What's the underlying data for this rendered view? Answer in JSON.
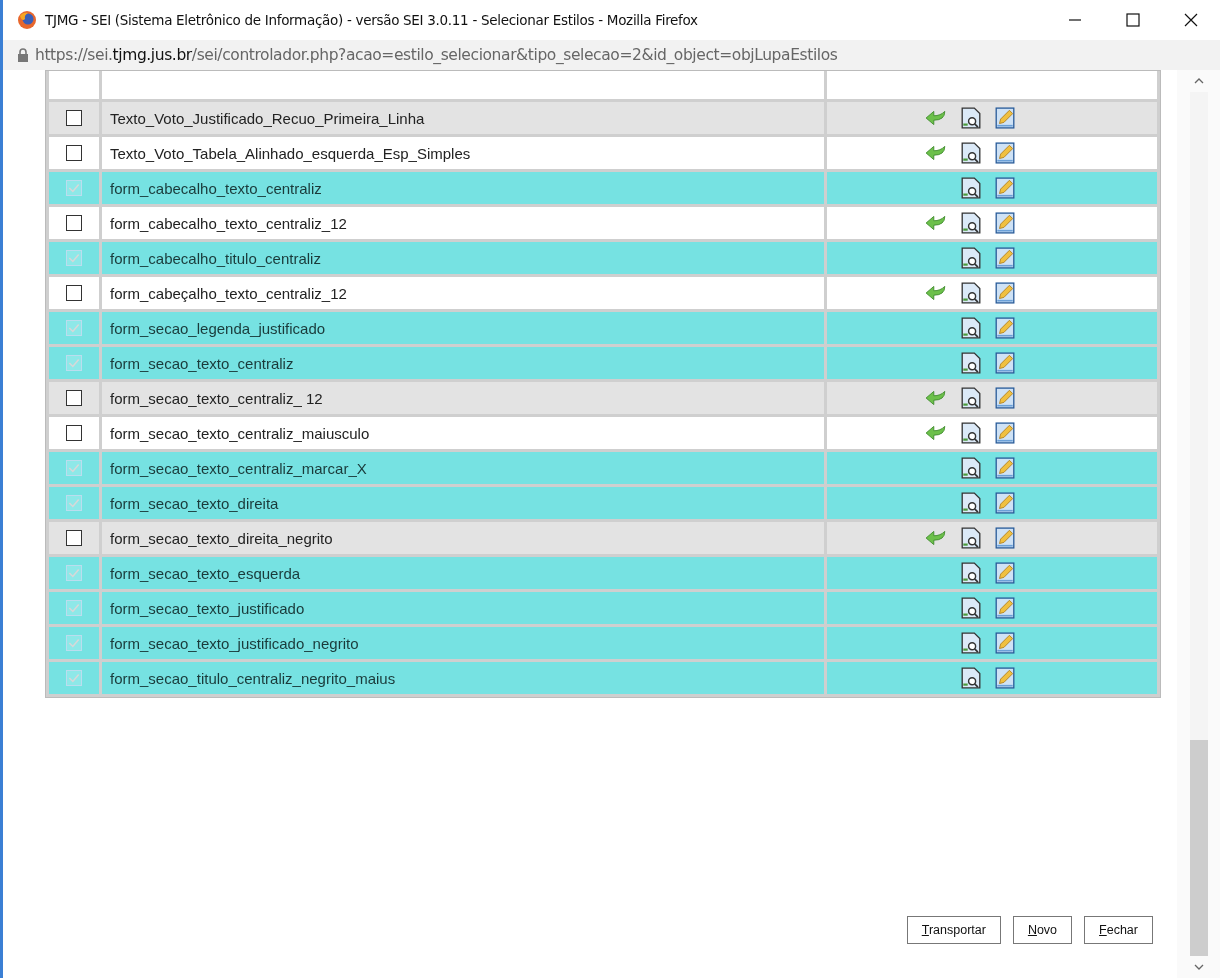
{
  "window": {
    "title": "TJMG - SEI (Sistema Eletrônico de Informação) - versão SEI 3.0.11 - Selecionar Estilos - Mozilla Firefox"
  },
  "address": {
    "prefix": "https://sei.",
    "domain": "tjmg.jus.br",
    "path": "/sei/controlador.php?acao=estilo_selecionar&tipo_selecao=2&id_object=objLupaEstilos"
  },
  "rows": [
    {
      "name": "Texto_Voto_Justificado_Recuo_Primeira_Linha",
      "selected": false,
      "shaded": true
    },
    {
      "name": "Texto_Voto_Tabela_Alinhado_esquerda_Esp_Simples",
      "selected": false,
      "shaded": false
    },
    {
      "name": "form_cabecalho_texto_centraliz",
      "selected": true
    },
    {
      "name": "form_cabecalho_texto_centraliz_12",
      "selected": false,
      "shaded": false
    },
    {
      "name": "form_cabecalho_titulo_centraliz",
      "selected": true
    },
    {
      "name": "form_cabeçalho_texto_centraliz_12",
      "selected": false,
      "shaded": false
    },
    {
      "name": "form_secao_legenda_justificado",
      "selected": true
    },
    {
      "name": "form_secao_texto_centraliz",
      "selected": true
    },
    {
      "name": "form_secao_texto_centraliz_ 12",
      "selected": false,
      "shaded": true
    },
    {
      "name": "form_secao_texto_centraliz_maiusculo",
      "selected": false,
      "shaded": false
    },
    {
      "name": "form_secao_texto_centraliz_marcar_X",
      "selected": true
    },
    {
      "name": "form_secao_texto_direita",
      "selected": true
    },
    {
      "name": "form_secao_texto_direita_negrito",
      "selected": false,
      "shaded": true
    },
    {
      "name": "form_secao_texto_esquerda",
      "selected": true
    },
    {
      "name": "form_secao_texto_justificado",
      "selected": true
    },
    {
      "name": "form_secao_texto_justificado_negrito",
      "selected": true
    },
    {
      "name": "form_secao_titulo_centraliz_negrito_maius",
      "selected": true
    }
  ],
  "buttons": [
    "Transportar",
    "Novo",
    "Fechar"
  ]
}
